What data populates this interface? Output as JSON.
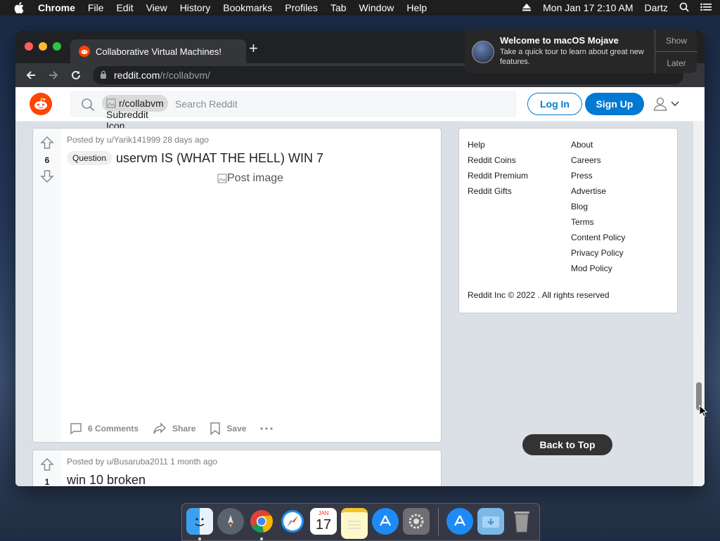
{
  "menubar": {
    "app": "Chrome",
    "items": [
      "File",
      "Edit",
      "View",
      "History",
      "Bookmarks",
      "Profiles",
      "Tab",
      "Window",
      "Help"
    ],
    "clock": "Mon Jan 17  2:10 AM",
    "user": "Dartz"
  },
  "browser": {
    "tab_title": "Collaborative Virtual Machines!",
    "url_host": "reddit.com",
    "url_path": "/r/collabvm/"
  },
  "notification": {
    "title": "Welcome to macOS Mojave",
    "body": "Take a quick tour to learn about great new features.",
    "show_label": "Show",
    "later_label": "Later"
  },
  "header": {
    "subreddit_chip": "r/collabvm",
    "subreddit_icon_alt": "Subreddit Icon",
    "search_placeholder": "Search Reddit",
    "login_label": "Log In",
    "signup_label": "Sign Up"
  },
  "posts": [
    {
      "votes": "6",
      "meta": "Posted by u/Yarik141999 28 days ago",
      "flair": "Question",
      "title": "uservm IS (WHAT THE HELL) WIN 7",
      "image_alt": "Post image",
      "comments": "6 Comments",
      "share": "Share",
      "save": "Save"
    },
    {
      "votes": "1",
      "meta": "Posted by u/Busaruba2011 1 month ago",
      "title": "win 10 broken"
    }
  ],
  "sidebar": {
    "left_links": [
      "Help",
      "Reddit Coins",
      "Reddit Premium",
      "Reddit Gifts"
    ],
    "right_links": [
      "About",
      "Careers",
      "Press",
      "Advertise",
      "Blog",
      "Terms",
      "Content Policy",
      "Privacy Policy",
      "Mod Policy"
    ],
    "copyright": "Reddit Inc © 2022 . All rights reserved"
  },
  "back_to_top": "Back to Top",
  "dock": {
    "items": [
      "finder-icon",
      "launchpad-icon",
      "chrome-icon",
      "safari-icon",
      "calendar-icon",
      "notes-icon",
      "app-store-icon",
      "system-preferences-icon",
      "app-store-download-icon",
      "downloads-folder-icon",
      "trash-icon"
    ],
    "calendar_day": "17",
    "calendar_month": "JAN"
  },
  "colors": {
    "reddit_orange": "#ff4500",
    "reddit_blue": "#0079d3",
    "page_bg": "#dae0e6"
  }
}
